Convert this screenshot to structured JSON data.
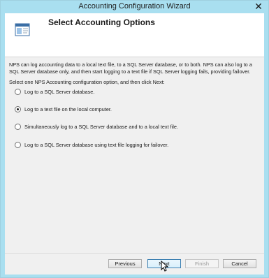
{
  "window": {
    "title": "Accounting Configuration Wizard",
    "close_glyph": "✕"
  },
  "header": {
    "title": "Select Accounting Options",
    "icon": "wizard-window-icon"
  },
  "content": {
    "description": "NPS can log accounting data to a local text file, to a SQL Server database, or to both. NPS can also log to a SQL Server database only, and then start logging to a text file if SQL Server logging fails, providing failover.",
    "instruction": "Select one NPS Accounting configuration option, and then click Next:",
    "options": [
      {
        "label": "Log to a SQL Server database.",
        "selected": false
      },
      {
        "label": "Log to a text file on the local computer.",
        "selected": true
      },
      {
        "label": "Simultaneously log to a SQL Server database and to a local text file.",
        "selected": false
      },
      {
        "label": "Log to a SQL Server database using text file logging for failover.",
        "selected": false
      }
    ]
  },
  "buttons": {
    "previous": "Previous",
    "next": "Next",
    "finish": "Finish",
    "cancel": "Cancel"
  },
  "colors": {
    "titlebar": "#a9dff0",
    "header_bg": "#ffffff",
    "dialog_bg": "#f0f0f0"
  }
}
